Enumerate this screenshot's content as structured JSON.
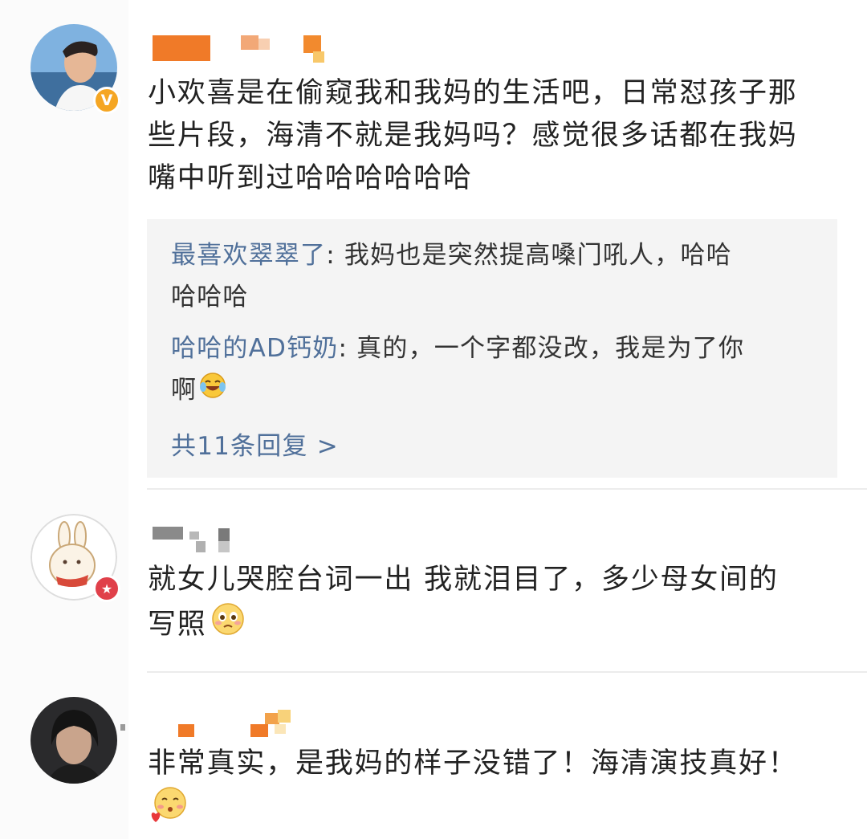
{
  "comments": [
    {
      "text_lines": [
        "小欢喜是在偷窥我和我妈的生活吧，日常怼孩子那",
        "些片段，海清不就是我妈吗？感觉很多话都在我妈",
        "嘴中听到过哈哈哈哈哈哈"
      ],
      "avatar_badge": "V",
      "username_blur_color": "#f07a28",
      "replies": [
        {
          "author": "最喜欢翠翠了",
          "text_line1": ": 我妈也是突然提高嗓门吼人，哈哈",
          "text_line2": "哈哈哈"
        },
        {
          "author": "哈哈的AD钙奶",
          "text_line1": ": 真的，一个字都没改，我是为了你",
          "text_line2": "啊"
        }
      ],
      "reply_total": "共11条回复 >"
    },
    {
      "text_lines": [
        "就女儿哭腔台词一出 我就泪目了，多少母女间的",
        "写照"
      ],
      "avatar_badge": "★",
      "username_blur_color": "#8a8a8a"
    },
    {
      "text_lines": [
        "非常真实，是我妈的样子没错了！海清演技真好！"
      ],
      "username_blur_color": "#f07a28"
    }
  ],
  "colors": {
    "link_blue": "#50709a",
    "verified_badge": "#f5a623",
    "member_badge": "#e0404a",
    "reply_bg": "#f4f4f4"
  },
  "icons": [
    "laugh-cry-emoji",
    "teary-emoji",
    "love-blush-emoji"
  ]
}
